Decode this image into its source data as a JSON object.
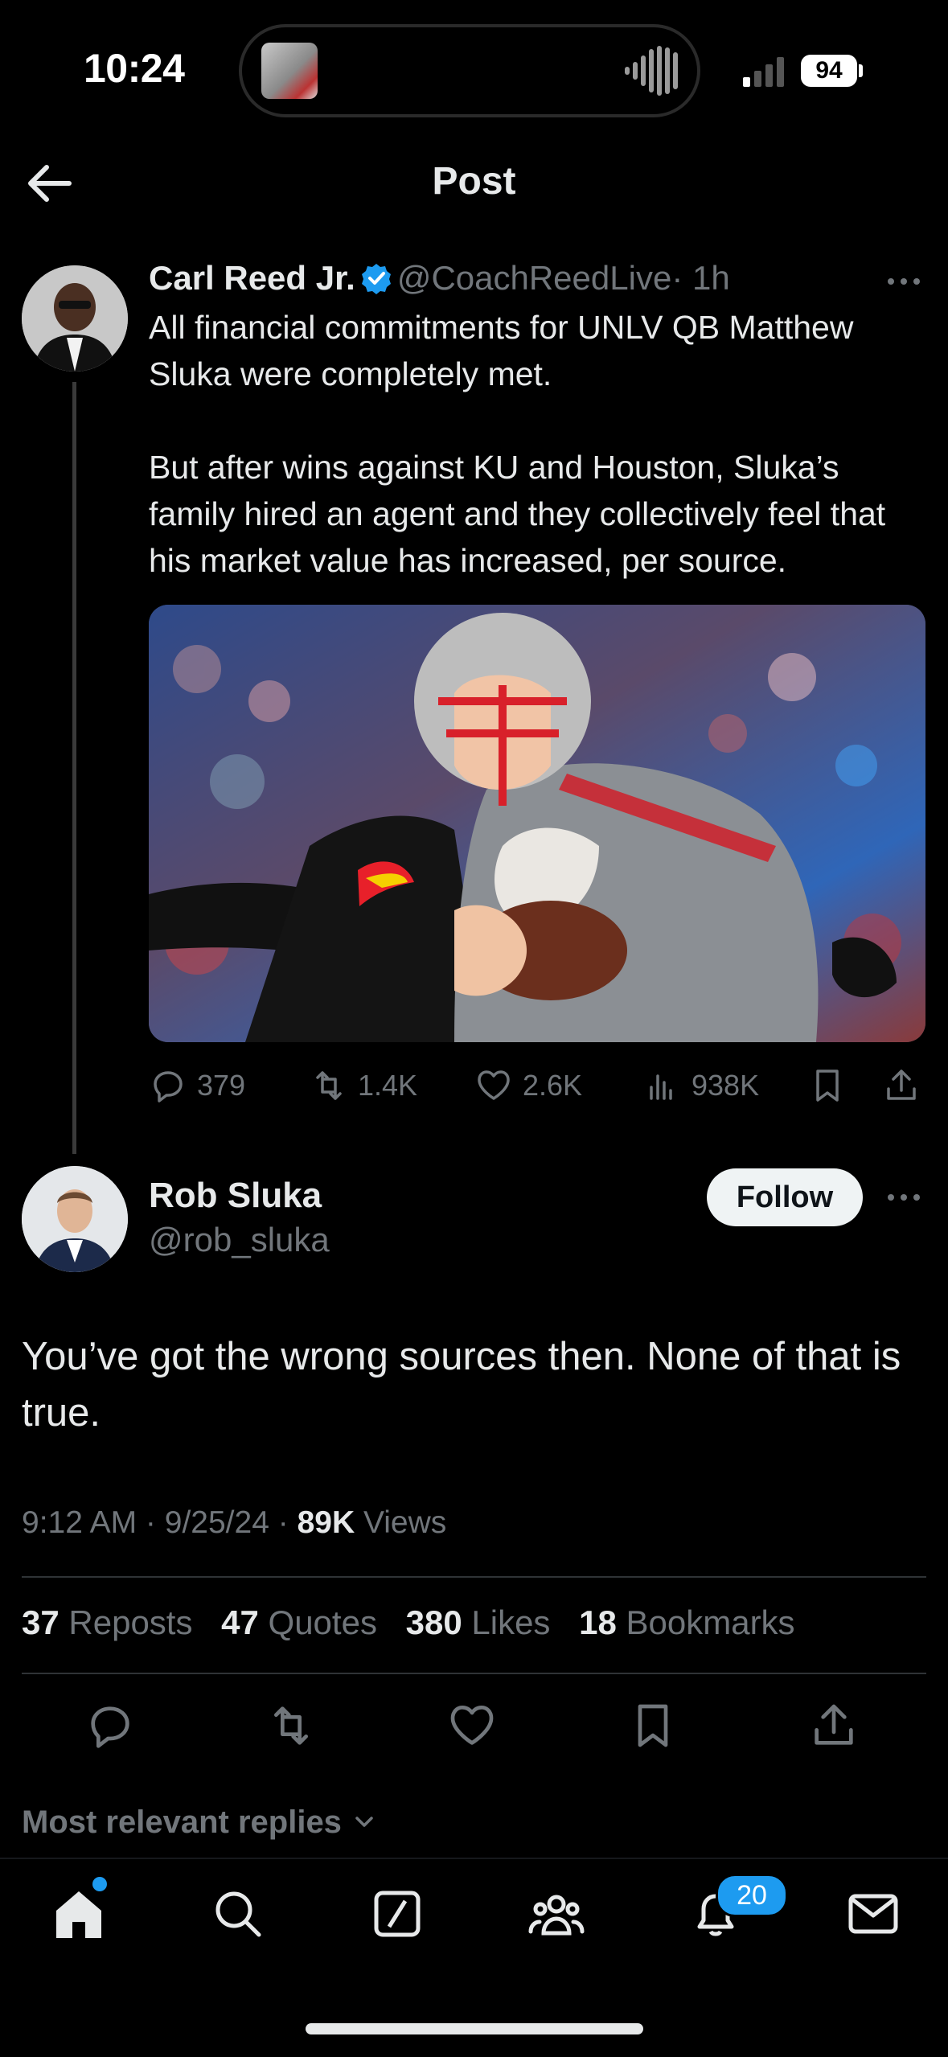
{
  "status_bar": {
    "time": "10:24",
    "battery": "94"
  },
  "header": {
    "title": "Post"
  },
  "post": {
    "author_name": "Carl Reed Jr.",
    "author_handle": "@CoachReedLive",
    "time": "· 1h",
    "text": "All financial commitments for UNLV QB Matthew Sluka were completely met.\n\nBut after wins against KU and Houston, Sluka’s family hired an agent and they collectively feel that his market value has increased, per source.",
    "actions": {
      "replies": "379",
      "reposts": "1.4K",
      "likes": "2.6K",
      "views": "938K"
    }
  },
  "reply": {
    "author_name": "Rob Sluka",
    "author_handle": "@rob_sluka",
    "follow_label": "Follow",
    "text": "You’ve got the wrong sources then. None of that is true.",
    "time": "9:12 AM",
    "date": "9/25/24",
    "views_count": "89K",
    "views_label": "Views",
    "stats": {
      "reposts_count": "37",
      "reposts_label": "Reposts",
      "quotes_count": "47",
      "quotes_label": "Quotes",
      "likes_count": "380",
      "likes_label": "Likes",
      "bookmarks_count": "18",
      "bookmarks_label": "Bookmarks"
    }
  },
  "replies_sort": "Most relevant replies",
  "tabbar": {
    "notifications_badge": "20"
  },
  "colors": {
    "background": "#000000",
    "accent": "#1d9bf0",
    "muted": "#71767b",
    "text": "#e7e9ea"
  }
}
